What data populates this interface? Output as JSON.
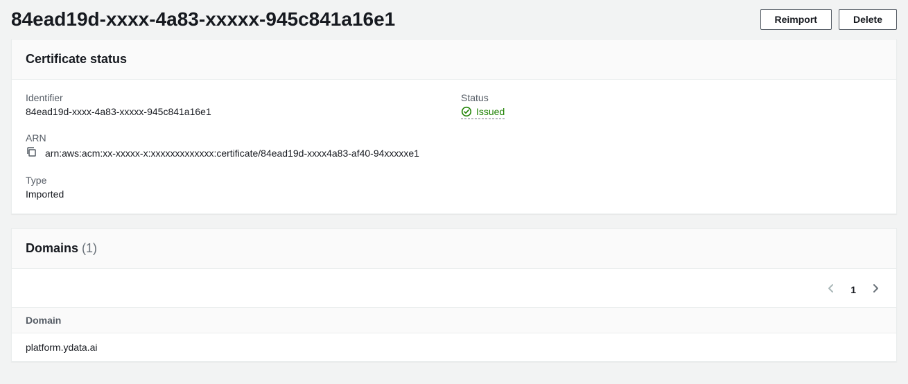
{
  "header": {
    "title": "84ead19d-xxxx-4a83-xxxxx-945c841a16e1",
    "reimport_label": "Reimport",
    "delete_label": "Delete"
  },
  "status_panel": {
    "title": "Certificate status",
    "identifier_label": "Identifier",
    "identifier_value": "84ead19d-xxxx-4a83-xxxxx-945c841a16e1",
    "arn_label": "ARN",
    "arn_value": "arn:aws:acm:xx-xxxxx-x:xxxxxxxxxxxxx:certificate/84ead19d-xxxx4a83-af40-94xxxxxe1",
    "type_label": "Type",
    "type_value": "Imported",
    "status_label": "Status",
    "status_value": "Issued"
  },
  "domains_panel": {
    "title": "Domains",
    "count": "(1)",
    "page": "1",
    "column_domain": "Domain",
    "rows": [
      {
        "domain": "platform.ydata.ai"
      }
    ]
  }
}
